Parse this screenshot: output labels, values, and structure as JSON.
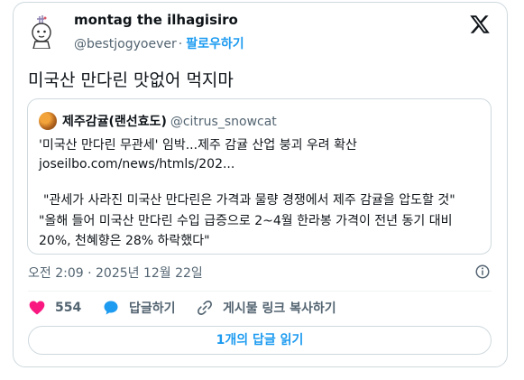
{
  "author": {
    "name": "montag the ilhagisiro",
    "handle": "@bestjogyoever",
    "separator": "·",
    "follow_label": "팔로우하기"
  },
  "tweet": {
    "text": "미국산 만다린 맛없어 먹지마"
  },
  "quote": {
    "name": "제주감귤(랜선효도)",
    "handle": "@citrus_snowcat",
    "lines": [
      "'미국산 만다린 무관세' 임박...제주 감귤 산업 붕괴 우려 확산",
      "joseilbo.com/news/htmls/202...",
      "\"관세가 사라진 미국산 만다린은 가격과 물량 경쟁에서 제주 감귤을 압도할 것\"",
      "\"올해 들어 미국산 만다린 수입 급증으로 2~4월 한라봉 가격이 전년 동기 대비",
      "20%, 천혜향은 28% 하락했다\""
    ]
  },
  "timestamp": "오전 2:09 · 2025년 12월 22일",
  "actions": {
    "like_count": "554",
    "reply_label": "답글하기",
    "copy_link_label": "게시물 링크 복사하기"
  },
  "read_replies_label": "1개의 답글 읽기",
  "colors": {
    "accent": "#1d9bf0",
    "like": "#f91880",
    "muted": "#536471",
    "border": "#cfd9de"
  }
}
